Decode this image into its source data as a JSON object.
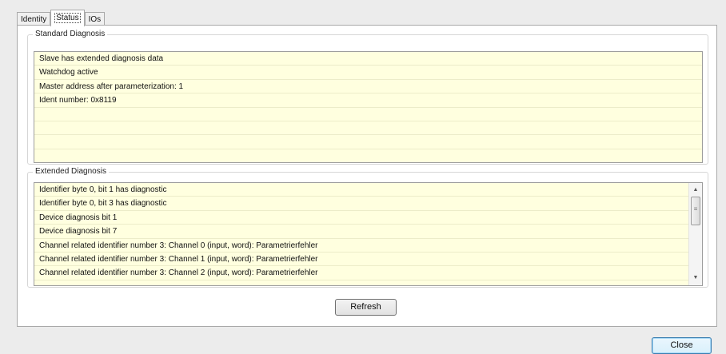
{
  "tabs": [
    {
      "label": "Identity"
    },
    {
      "label": "Status"
    },
    {
      "label": "IOs"
    }
  ],
  "standard_diagnosis": {
    "title": "Standard Diagnosis",
    "rows": [
      "Slave has extended diagnosis data",
      "Watchdog active",
      "Master address after parameterization: 1",
      "Ident number: 0x8119",
      "",
      "",
      "",
      ""
    ]
  },
  "extended_diagnosis": {
    "title": "Extended Diagnosis",
    "rows": [
      "Identifier byte 0, bit 1 has diagnostic",
      "Identifier byte 0, bit 3 has diagnostic",
      "Device diagnosis bit 1",
      "Device diagnosis bit 7",
      "Channel related identifier number 3: Channel 0 (input, word): Parametrierfehler",
      "Channel related identifier number 3: Channel 1 (input, word): Parametrierfehler",
      "Channel related identifier number 3: Channel 2 (input, word): Parametrierfehler"
    ]
  },
  "buttons": {
    "refresh": "Refresh",
    "close": "Close"
  }
}
